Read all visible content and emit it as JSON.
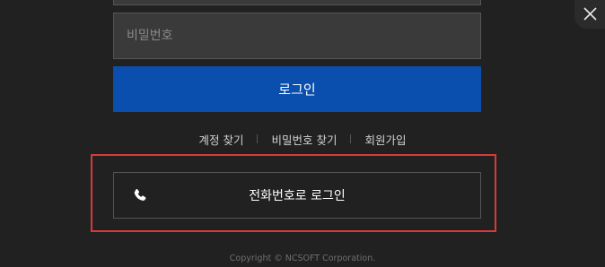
{
  "login": {
    "password_placeholder": "비밀번호",
    "login_label": "로그인"
  },
  "links": {
    "find_account": "계정 찾기",
    "find_password": "비밀번호 찾기",
    "sign_up": "회원가입"
  },
  "phone_login": {
    "label": "전화번호로 로그인",
    "icon": "phone-icon"
  },
  "footer": {
    "copyright": "Copyright © NCSOFT Corporation."
  },
  "close": {
    "icon": "close-icon"
  },
  "colors": {
    "background": "#212121",
    "primary_button": "#0a4fae",
    "highlight": "#d9393a"
  }
}
